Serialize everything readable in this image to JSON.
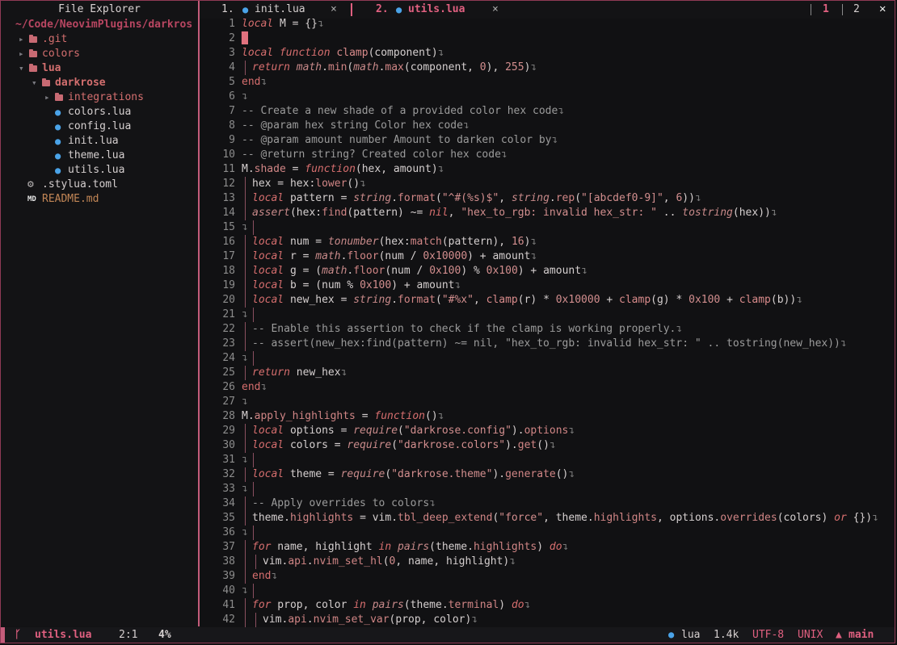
{
  "sidebar": {
    "title": "File Explorer",
    "root_path": "~/Code/NeovimPlugins/darkros",
    "items": [
      {
        "label": ".git",
        "icon": "folder-icon",
        "chevron": "▸",
        "depth": 0
      },
      {
        "label": "colors",
        "icon": "folder-icon",
        "chevron": "▸",
        "depth": 0
      },
      {
        "label": "lua",
        "icon": "folder-icon",
        "chevron": "▾",
        "depth": 0
      },
      {
        "label": "darkrose",
        "icon": "folder-icon",
        "chevron": "▾",
        "depth": 1
      },
      {
        "label": "integrations",
        "icon": "folder-icon",
        "chevron": "▸",
        "depth": 2
      },
      {
        "label": "colors.lua",
        "icon": "lua-icon",
        "depth": 2
      },
      {
        "label": "config.lua",
        "icon": "lua-icon",
        "depth": 2
      },
      {
        "label": "init.lua",
        "icon": "lua-icon",
        "depth": 2
      },
      {
        "label": "theme.lua",
        "icon": "lua-icon",
        "depth": 2
      },
      {
        "label": "utils.lua",
        "icon": "lua-icon",
        "depth": 2
      },
      {
        "label": ".stylua.toml",
        "icon": "gear-icon",
        "depth": 0
      },
      {
        "label": "README.md",
        "icon": "markdown-icon",
        "depth": 0
      }
    ]
  },
  "tabs": [
    {
      "num": "1.",
      "name": "init.lua",
      "close": "×",
      "active": false
    },
    {
      "num": "2.",
      "name": "utils.lua",
      "close": "×",
      "active": true
    }
  ],
  "tab_counts": [
    "1",
    "2"
  ],
  "close_all": "✕",
  "eol_char": "↴",
  "code_lines": [
    "local M = {}",
    "",
    "local function clamp(component)",
    "  return math.min(math.max(component, 0), 255)",
    "end",
    "",
    "-- Create a new shade of a provided color hex code",
    "-- @param hex string Color hex code",
    "-- @param amount number Amount to darken color by",
    "-- @return string? Created color hex code",
    "M.shade = function(hex, amount)",
    "  hex = hex:lower()",
    "  local pattern = string.format(\"^#(%s)$\", string.rep(\"[abcdef0-9]\", 6))",
    "  assert(hex:find(pattern) ~= nil, \"hex_to_rgb: invalid hex_str: \" .. tostring(hex))",
    "",
    "  local num = tonumber(hex:match(pattern), 16)",
    "  local r = math.floor(num / 0x10000) + amount",
    "  local g = (math.floor(num / 0x100) % 0x100) + amount",
    "  local b = (num % 0x100) + amount",
    "  local new_hex = string.format(\"#%x\", clamp(r) * 0x10000 + clamp(g) * 0x100 + clamp(b))",
    "",
    "  -- Enable this assertion to check if the clamp is working properly.",
    "  -- assert(new_hex:find(pattern) ~= nil, \"hex_to_rgb: invalid hex_str: \" .. tostring(new_hex))",
    "",
    "  return new_hex",
    "end",
    "",
    "M.apply_highlights = function()",
    "  local options = require(\"darkrose.config\").options",
    "  local colors = require(\"darkrose.colors\").get()",
    "",
    "  local theme = require(\"darkrose.theme\").generate()",
    "",
    "  -- Apply overrides to colors",
    "  theme.highlights = vim.tbl_deep_extend(\"force\", theme.highlights, options.overrides(colors) or {})",
    "",
    "  for name, highlight in pairs(theme.highlights) do",
    "    vim.api.nvim_set_hl(0, name, highlight)",
    "  end",
    "",
    "  for prop, color in pairs(theme.terminal) do",
    "    vim.api.nvim_set_var(prop, color)"
  ],
  "statusline": {
    "branch_icon": "ᚴ",
    "filename": "utils.lua",
    "position": "2:1",
    "percent": "4%",
    "filetype_icon": "lua-icon",
    "filetype": "lua",
    "size": "1.4k",
    "encoding": "UTF-8",
    "fileformat": "UNIX",
    "git_icon": "tree-icon",
    "branch": "main"
  },
  "colors": {
    "accent": "#e06080",
    "border": "#8f3a55",
    "folder": "#d46f6f",
    "lua": "#4aa3e8",
    "background": "#111113"
  }
}
